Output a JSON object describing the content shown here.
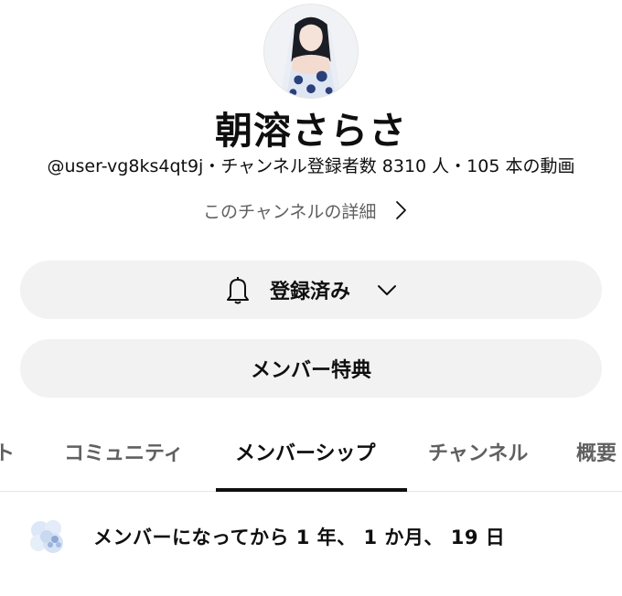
{
  "channel": {
    "name": "朝溶さらさ",
    "meta": "@user-vg8ks4qt9j・チャンネル登録者数 8310 人・105 本の動画",
    "details_link": "このチャンネルの詳細"
  },
  "buttons": {
    "subscribed_label": "登録済み",
    "perks_label": "メンバー特典"
  },
  "tabs": [
    {
      "label": "ト",
      "active": false
    },
    {
      "label": "コミュニティ",
      "active": false
    },
    {
      "label": "メンバーシップ",
      "active": true
    },
    {
      "label": "チャンネル",
      "active": false
    },
    {
      "label": "概要",
      "active": false
    }
  ],
  "membership": {
    "duration_text": "メンバーになってから 1 年、 1 か月、 19 日",
    "badge_icon": "membership-badge-icon"
  },
  "colors": {
    "pill_bg": "#f2f2f2",
    "secondary_text": "#606060",
    "primary_text": "#0f0f0f"
  }
}
